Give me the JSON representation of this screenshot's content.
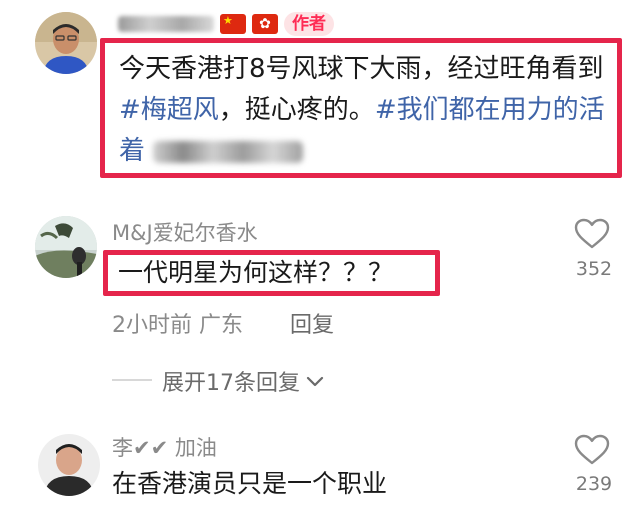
{
  "comment1": {
    "is_author_badge": "作者",
    "text_main": "今天香港打8号风球下大雨，经过旺角看到",
    "tag1": "#梅超风",
    "text_mid": "，挺心疼的。",
    "tag2": "#我们都在用力的活着",
    "flags": [
      "china-flag-icon",
      "hong-kong-flag-icon"
    ]
  },
  "comment2": {
    "username": "M&J爱妃尔香水",
    "text": "一代明星为何这样？？？",
    "time_location": "2小时前 广东",
    "reply_label": "回复",
    "likes": "352"
  },
  "expand": {
    "label": "展开17条回复",
    "icon": "chevron-down-icon"
  },
  "comment3": {
    "username": "李✔✔ 加油",
    "text": "在香港演员只是一个职业",
    "likes": "239"
  },
  "colors": {
    "highlight_border": "#e5254b",
    "hashtag": "#3f64a8",
    "author_badge": "#fe2c55",
    "secondary_text": "#8a8a8a"
  }
}
